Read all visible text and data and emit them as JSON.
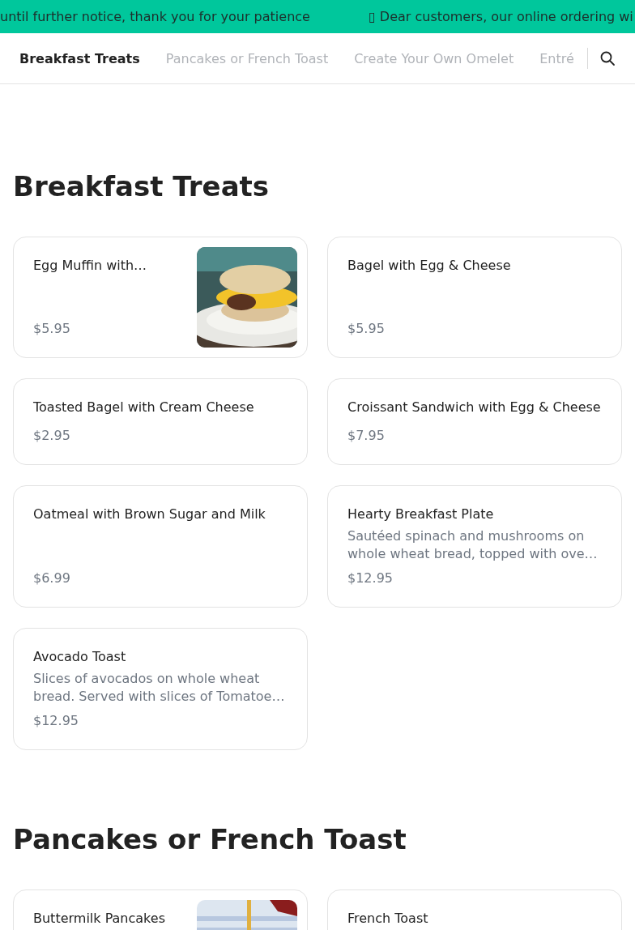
{
  "banner": {
    "messages": [
      {
        "text": "until further notice, thank you for your patience"
      },
      {
        "text": "▯ Dear customers, our online ordering wi"
      }
    ]
  },
  "nav": {
    "tabs": [
      {
        "label": "Breakfast Treats",
        "selected": true
      },
      {
        "label": "Pancakes or French Toast",
        "selected": false
      },
      {
        "label": "Create Your Own Omelet",
        "selected": false
      },
      {
        "label": "Entré",
        "selected": false
      }
    ]
  },
  "sections": [
    {
      "title": "Breakfast Treats",
      "items": [
        {
          "name": "Egg Muffin with…",
          "price": "$5.95"
        },
        {
          "name": "Bagel with Egg & Cheese",
          "price": "$5.95"
        },
        {
          "name": "Toasted Bagel with Cream Cheese",
          "price": "$2.95"
        },
        {
          "name": "Croissant Sandwich with Egg & Cheese",
          "price": "$7.95"
        },
        {
          "name": "Oatmeal with Brown Sugar and Milk",
          "price": "$6.99"
        },
        {
          "name": "Hearty Breakfast Plate",
          "description": "Sautéed spinach and mushrooms on whole wheat bread, topped with ove…",
          "price": "$12.95"
        },
        {
          "name": "Avocado Toast",
          "description": "Slices of avocados on whole wheat bread. Served with slices of Tomatoe…",
          "price": "$12.95"
        }
      ]
    },
    {
      "title": "Pancakes or French Toast",
      "items": [
        {
          "name": "Buttermilk Pancakes"
        },
        {
          "name": "French Toast"
        }
      ]
    }
  ]
}
